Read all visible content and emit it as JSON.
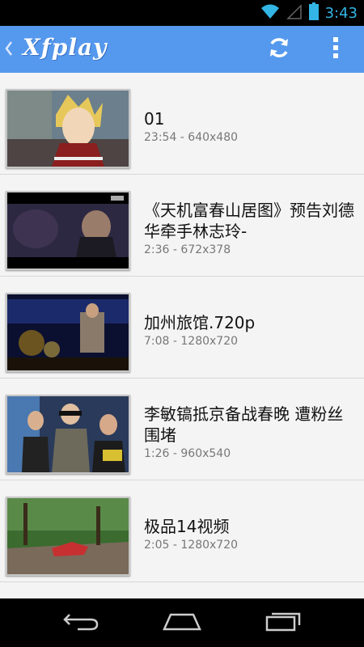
{
  "status_bar": {
    "time": "3:43",
    "icons": [
      "wifi-icon",
      "signal-icon",
      "battery-icon"
    ],
    "accent": "#33b5e5"
  },
  "app_bar": {
    "title": "Xfplay",
    "color": "#5599ee",
    "actions": [
      "refresh-icon",
      "overflow-menu-icon"
    ]
  },
  "videos": [
    {
      "title": "01",
      "meta": "23:54 - 640x480"
    },
    {
      "title": "《天机富春山居图》预告刘德华牵手林志玲-",
      "meta": "2:36 - 672x378"
    },
    {
      "title": "加州旅馆.720p",
      "meta": "7:08 - 1280x720"
    },
    {
      "title": "李敏镐抵京备战春晚 遭粉丝围堵",
      "meta": "1:26 - 960x540"
    },
    {
      "title": "极品14视频",
      "meta": "2:05 - 1280x720"
    }
  ],
  "nav_bar": {
    "buttons": [
      "back-icon",
      "home-icon",
      "recent-apps-icon"
    ]
  }
}
